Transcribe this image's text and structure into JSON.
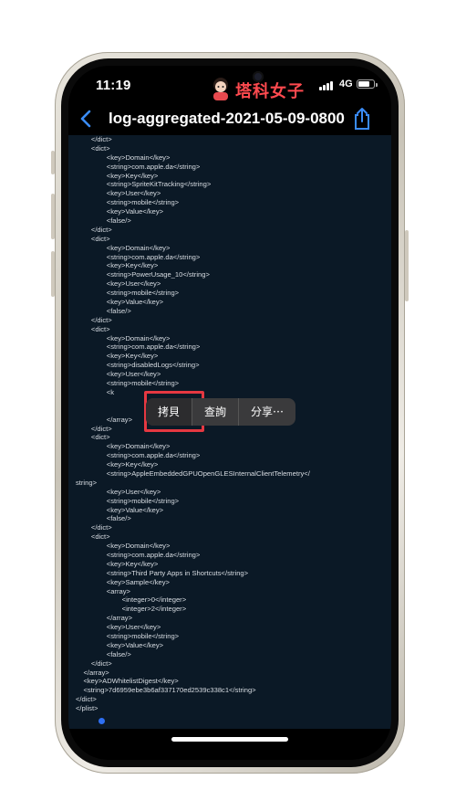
{
  "status": {
    "time": "11:19",
    "network": "4G"
  },
  "nav": {
    "title": "log-aggregated-2021-05-09-0800..."
  },
  "brand": {
    "text": "塔科女子"
  },
  "code_lines": [
    "        </dict>",
    "        <dict>",
    "                <key>Domain</key>",
    "                <string>com.apple.da</string>",
    "                <key>Key</key>",
    "                <string>SpriteKitTracking</string>",
    "                <key>User</key>",
    "                <string>mobile</string>",
    "                <key>Value</key>",
    "                <false/>",
    "        </dict>",
    "        <dict>",
    "                <key>Domain</key>",
    "                <string>com.apple.da</string>",
    "                <key>Key</key>",
    "                <string>PowerUsage_10</string>",
    "                <key>User</key>",
    "                <string>mobile</string>",
    "                <key>Value</key>",
    "                <false/>",
    "        </dict>",
    "        <dict>",
    "                <key>Domain</key>",
    "                <string>com.apple.da</string>",
    "                <key>Key</key>",
    "                <string>disabledLogs</string>",
    "                <key>User</key>",
    "                <string>mobile</string>",
    "                <k",
    "                ",
    "                ",
    "                </array>",
    "        </dict>",
    "        <dict>",
    "                <key>Domain</key>",
    "                <string>com.apple.da</string>",
    "                <key>Key</key>",
    "                <string>AppleEmbeddedGPUOpenGLESInternalClientTelemetry</",
    "string>",
    "                <key>User</key>",
    "                <string>mobile</string>",
    "                <key>Value</key>",
    "                <false/>",
    "        </dict>",
    "        <dict>",
    "                <key>Domain</key>",
    "                <string>com.apple.da</string>",
    "                <key>Key</key>",
    "                <string>Third Party Apps in Shortcuts</string>",
    "                <key>Sample</key>",
    "                <array>",
    "                        <integer>0</integer>",
    "                        <integer>2</integer>",
    "                </array>",
    "                <key>User</key>",
    "                <string>mobile</string>",
    "                <key>Value</key>",
    "                <false/>",
    "        </dict>",
    "    </array>",
    "    <key>ADWhitelistDigest</key>",
    "    <string>7d6959ebe3b6af337170ed2539c338c1</string>",
    "</dict>",
    "</plist>"
  ],
  "menu": {
    "copy": "拷貝",
    "lookup": "查詢",
    "share": "分享⋯"
  },
  "colors": {
    "highlight": "#e53841",
    "accent": "#2e6ff2",
    "code_bg": "#0b1926"
  },
  "icons": [
    "back-chevron-icon",
    "share-icon",
    "signal-icon",
    "battery-icon"
  ]
}
